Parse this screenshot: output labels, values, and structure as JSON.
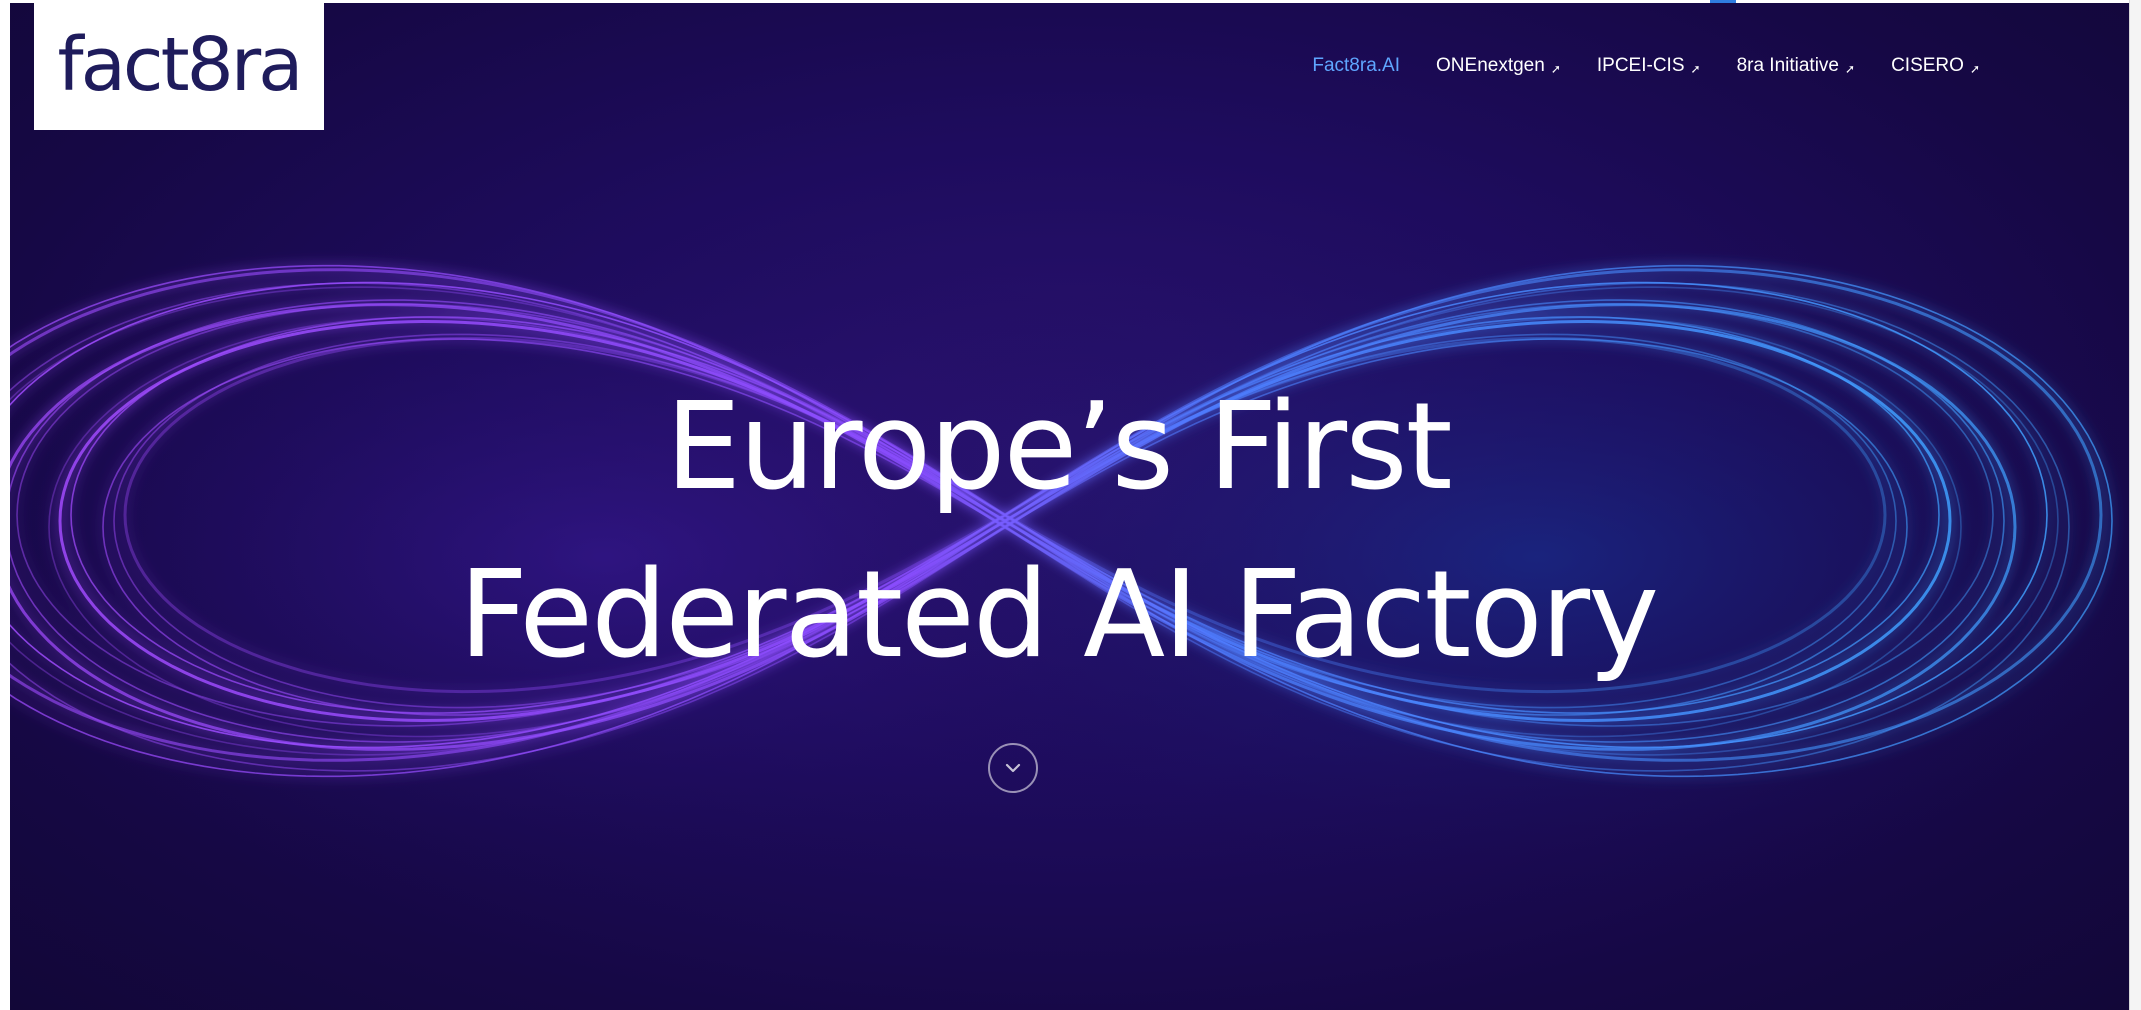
{
  "logo": {
    "text": "fact8ra"
  },
  "nav": {
    "items": [
      {
        "label": "Fact8ra.AI",
        "external": false,
        "active": true
      },
      {
        "label": "ONEnextgen",
        "external": true,
        "active": false
      },
      {
        "label": "IPCEI-CIS",
        "external": true,
        "active": false
      },
      {
        "label": "8ra Initiative",
        "external": true,
        "active": false
      },
      {
        "label": "CISERO",
        "external": true,
        "active": false
      }
    ]
  },
  "hero": {
    "line1": "Europe’s First",
    "line2": "Federated AI Factory"
  },
  "icons": {
    "external_link": "external-link-arrow-icon",
    "scroll_down": "chevron-down-circle-icon"
  },
  "colors": {
    "background": "#1a0a52",
    "nav_active": "#5fa6ff",
    "logo_text": "#1f1c5c",
    "glow_purple": "#a24bff",
    "glow_blue": "#3fa0ff"
  }
}
